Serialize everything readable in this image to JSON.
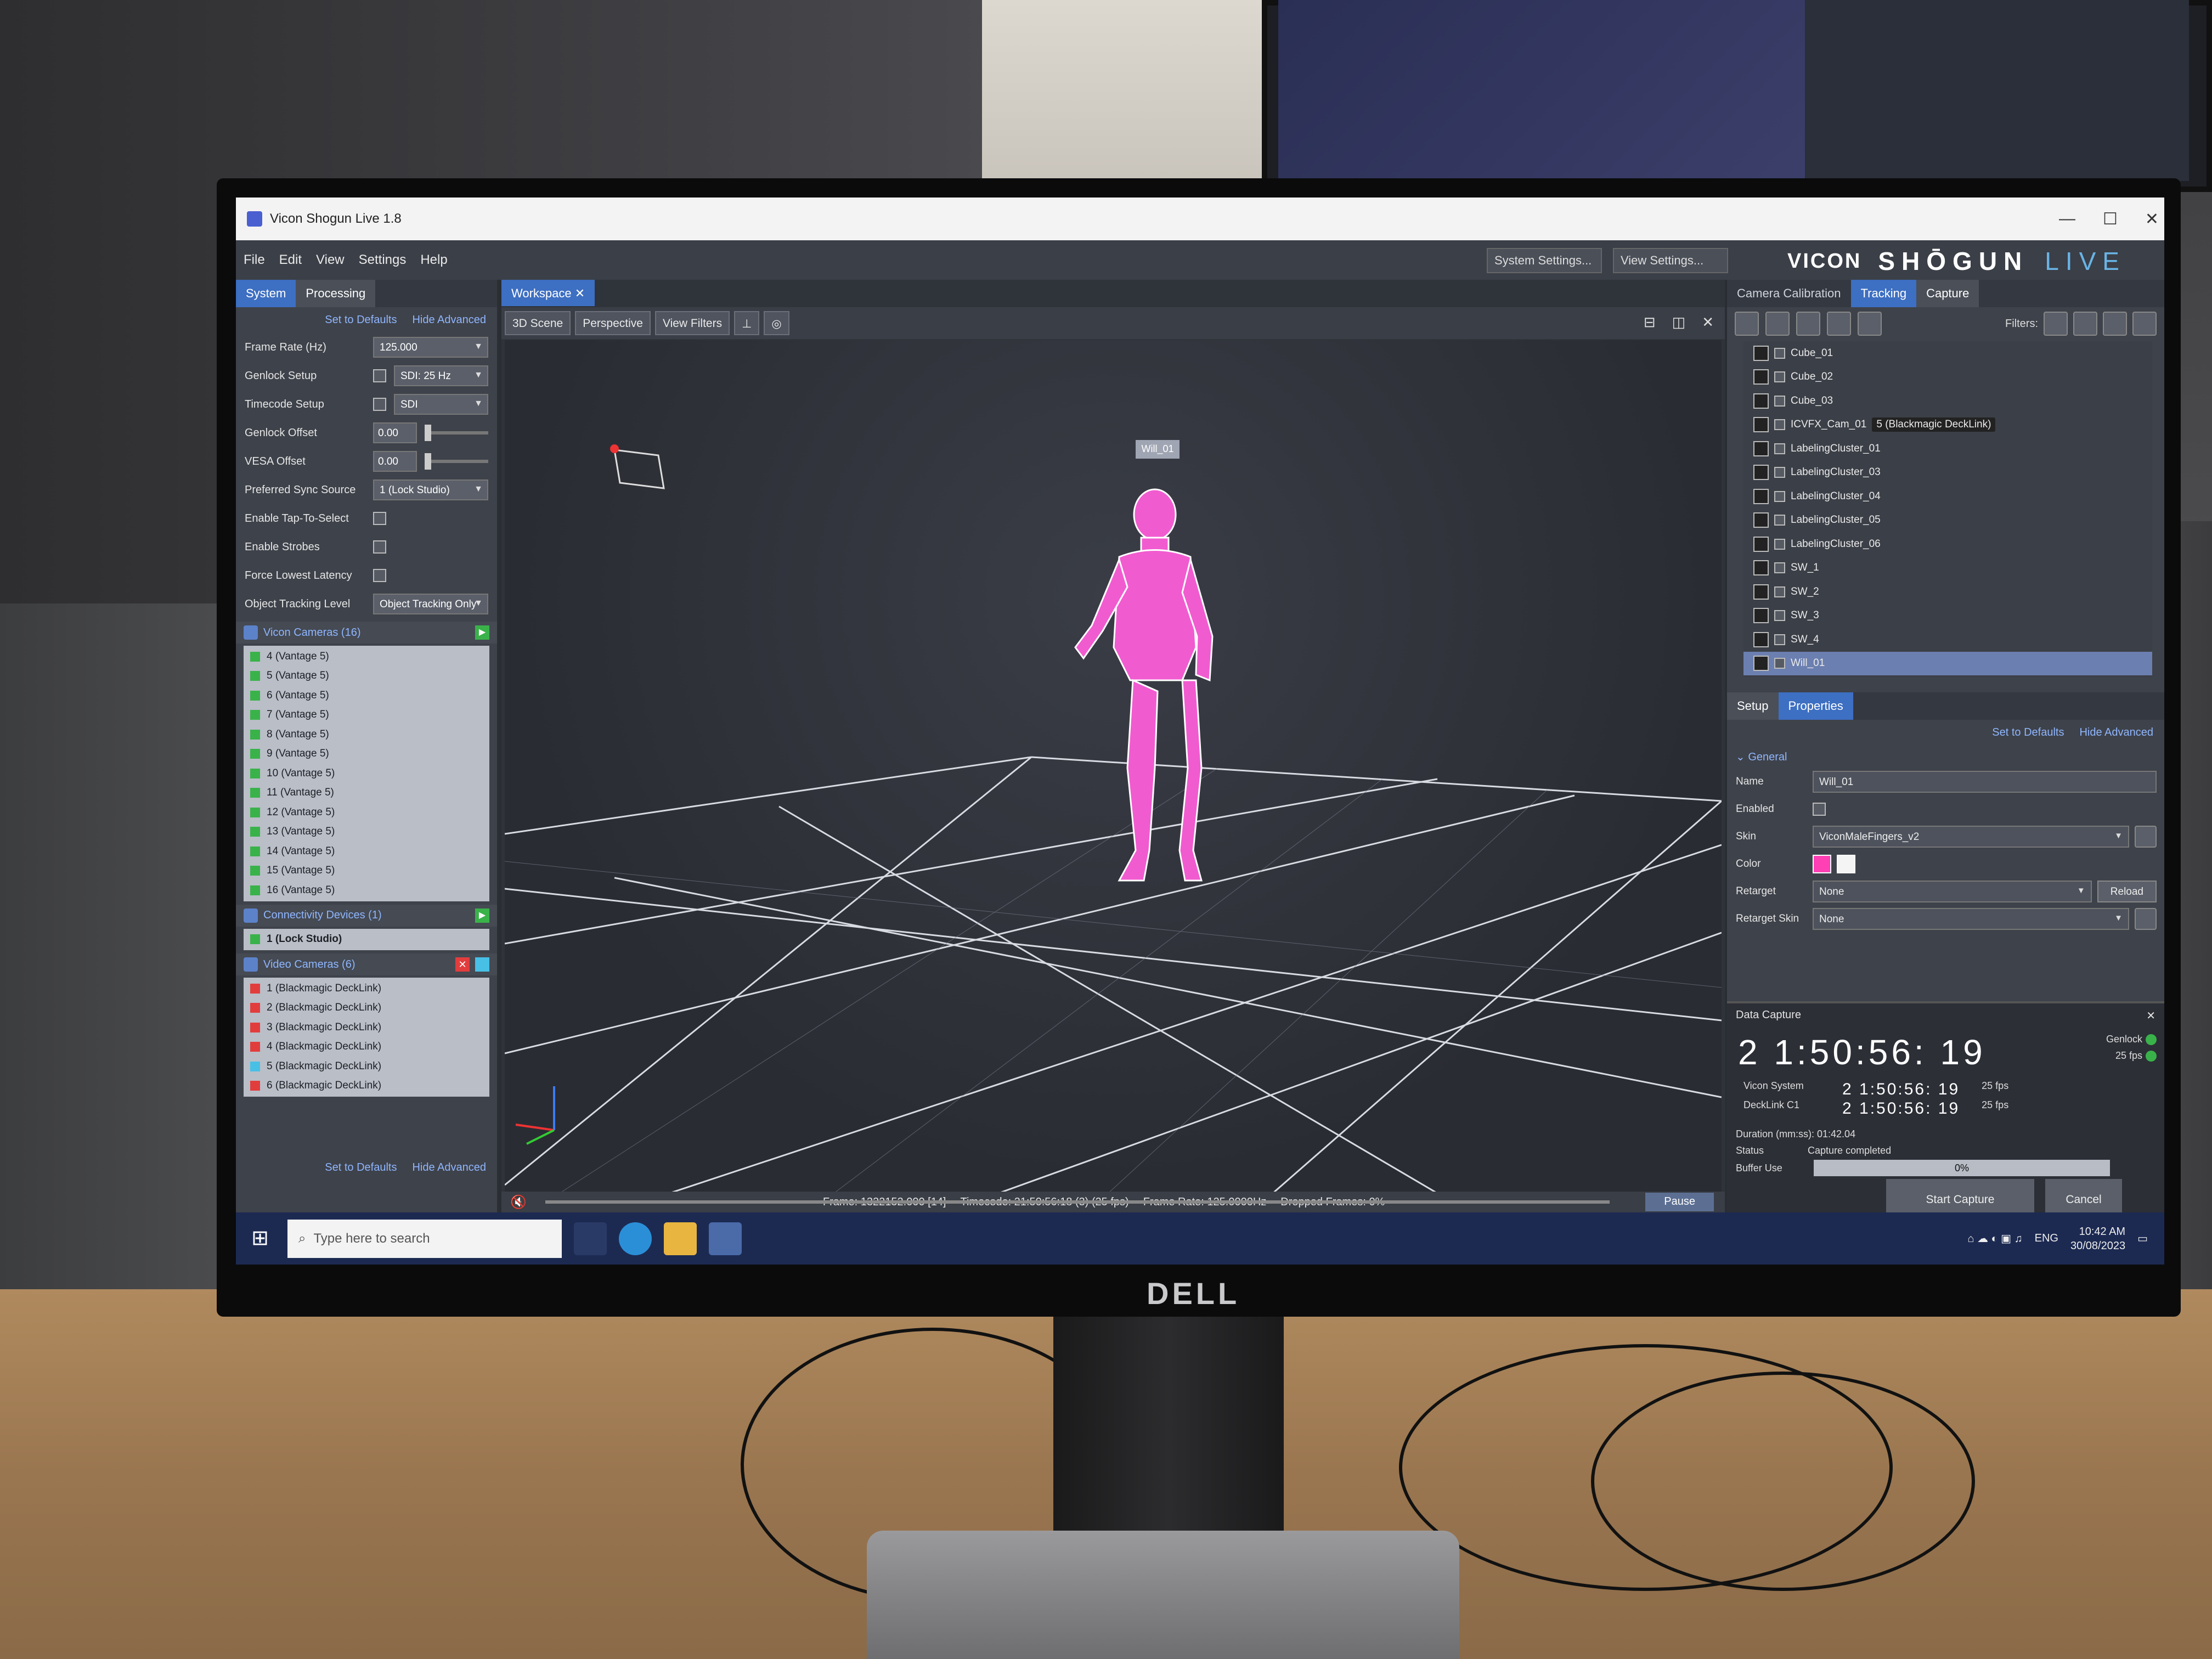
{
  "window": {
    "title": "Vicon Shogun Live 1.8",
    "controls": [
      "—",
      "☐",
      "✕"
    ]
  },
  "menu": [
    "File",
    "Edit",
    "View",
    "Settings",
    "Help"
  ],
  "menu_dropdowns": {
    "system_settings": "System Settings...",
    "view_settings": "View Settings..."
  },
  "brand": {
    "vicon": "VICON",
    "shogun": "SHŌGUN",
    "live": "LIVE"
  },
  "left_panel": {
    "tabs": [
      "System",
      "Processing"
    ],
    "set_to_defaults": "Set to Defaults",
    "hide_advanced": "Hide Advanced",
    "frame_rate": {
      "label": "Frame Rate (Hz)",
      "value": "125.000"
    },
    "genlock_setup": {
      "label": "Genlock Setup",
      "value": "SDI: 25 Hz"
    },
    "timecode_setup": {
      "label": "Timecode Setup",
      "value": "SDI"
    },
    "genlock_offset": {
      "label": "Genlock Offset",
      "value": "0.00"
    },
    "vesa_offset": {
      "label": "VESA Offset",
      "value": "0.00"
    },
    "preferred_sync": {
      "label": "Preferred Sync Source",
      "value": "1 (Lock Studio)"
    },
    "tap_to_select": {
      "label": "Enable Tap-To-Select"
    },
    "strobes": {
      "label": "Enable Strobes"
    },
    "lowest_latency": {
      "label": "Force Lowest Latency"
    },
    "object_tracking": {
      "label": "Object Tracking Level",
      "value": "Object Tracking Only"
    },
    "vicon_cameras_header": "Vicon Cameras (16)",
    "vicon_cameras": [
      "4 (Vantage 5)",
      "5 (Vantage 5)",
      "6 (Vantage 5)",
      "7 (Vantage 5)",
      "8 (Vantage 5)",
      "9 (Vantage 5)",
      "10 (Vantage 5)",
      "11 (Vantage 5)",
      "12 (Vantage 5)",
      "13 (Vantage 5)",
      "14 (Vantage 5)",
      "15 (Vantage 5)",
      "16 (Vantage 5)"
    ],
    "connectivity_header": "Connectivity Devices (1)",
    "connectivity": [
      "1 (Lock Studio)"
    ],
    "video_cameras_header": "Video Cameras (6)",
    "video_cameras": [
      "1 (Blackmagic DeckLink)",
      "2 (Blackmagic DeckLink)",
      "3 (Blackmagic DeckLink)",
      "4 (Blackmagic DeckLink)",
      "5 (Blackmagic DeckLink)",
      "6 (Blackmagic DeckLink)"
    ]
  },
  "workspace": {
    "tab": "Workspace",
    "scene": "3D Scene",
    "projection": "Perspective",
    "filters": "View Filters",
    "subject_label": "Will_01",
    "status": {
      "frame": "Frame: 1322152.000 [14]",
      "timecode": "Timecode: 21:50:56:18 (3) (25 fps)",
      "frame_rate": "Frame Rate: 125.0000Hz",
      "dropped": "Dropped Frames: 0%"
    },
    "pause": "Pause"
  },
  "right_panel": {
    "tabs": [
      "Camera Calibration",
      "Tracking",
      "Capture"
    ],
    "filters_label": "Filters:",
    "tree": [
      {
        "name": "Cube_01"
      },
      {
        "name": "Cube_02"
      },
      {
        "name": "Cube_03"
      },
      {
        "name": "ICVFX_Cam_01",
        "badge": "5 (Blackmagic DeckLink)"
      },
      {
        "name": "LabelingCluster_01"
      },
      {
        "name": "LabelingCluster_03"
      },
      {
        "name": "LabelingCluster_04"
      },
      {
        "name": "LabelingCluster_05"
      },
      {
        "name": "LabelingCluster_06"
      },
      {
        "name": "SW_1"
      },
      {
        "name": "SW_2"
      },
      {
        "name": "SW_3"
      },
      {
        "name": "SW_4"
      },
      {
        "name": "Will_01"
      }
    ],
    "sub_tabs": [
      "Setup",
      "Properties"
    ],
    "set_to_defaults": "Set to Defaults",
    "hide_advanced": "Hide Advanced",
    "general": "General",
    "name": {
      "label": "Name",
      "value": "Will_01"
    },
    "enabled": {
      "label": "Enabled"
    },
    "skin": {
      "label": "Skin",
      "value": "ViconMaleFingers_v2"
    },
    "color": {
      "label": "Color",
      "swatch": "#ff3fb4"
    },
    "retarget": {
      "label": "Retarget",
      "value": "None",
      "reload": "Reload"
    },
    "retarget_skin": {
      "label": "Retarget Skin",
      "value": "None"
    }
  },
  "data_capture": {
    "title": "Data Capture",
    "timecode": "2 1:50:56: 19",
    "genlock": "Genlock",
    "fps": "25 fps",
    "vicon_system": {
      "label": "Vicon System",
      "tc": "2 1:50:56: 19",
      "fps": "25 fps"
    },
    "decklink": {
      "label": "DeckLink C1",
      "tc": "2 1:50:56: 19",
      "fps": "25 fps"
    },
    "duration": "Duration (mm:ss): 01:42.04",
    "status_label": "Status",
    "status_value": "Capture completed",
    "buffer_label": "Buffer Use",
    "buffer_value": "0%",
    "start": "Start Capture",
    "cancel": "Cancel"
  },
  "taskbar": {
    "search_placeholder": "Type here to search",
    "lang": "ENG",
    "time": "10:42 AM",
    "date": "30/08/2023"
  },
  "bezel_logo": "DELL"
}
